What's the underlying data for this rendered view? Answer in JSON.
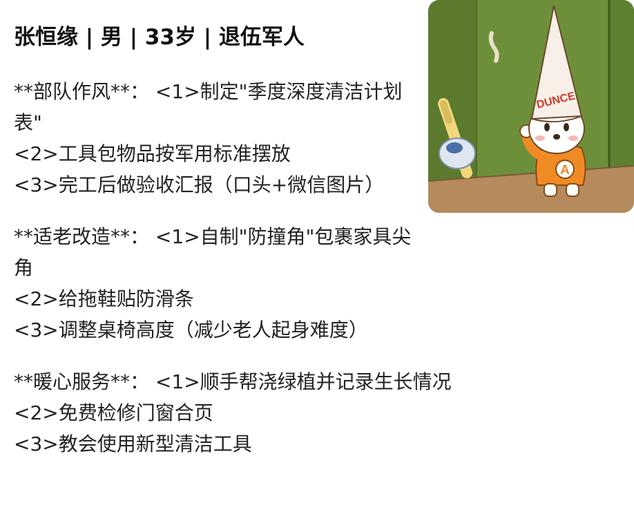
{
  "profile": {
    "title": "张恒缘 | 男 | 33岁 | 退伍军人"
  },
  "sections": [
    {
      "heading": "**部队作风**：",
      "first_item": "<1>制定\"季度深度清洁计划表\"",
      "items": [
        "<2>工具包物品按军用标准摆放",
        "<3>完工后做验收汇报（口头+微信图片）"
      ]
    },
    {
      "heading": "**适老改造**：",
      "first_item": "<1>自制\"防撞角\"包裹家具尖角",
      "items": [
        "<2>给拖鞋贴防滑条",
        "<3>调整桌椅高度（减少老人起身难度）"
      ]
    },
    {
      "heading": "**暖心服务**：",
      "first_item": "<1>顺手帮浇绿植并记录生长情况",
      "items": [
        "<2>免费检修门窗合页",
        "<3>教会使用新型清洁工具"
      ]
    }
  ],
  "image": {
    "hat_text": "DUNCE",
    "shirt_letter": "A",
    "colors": {
      "wall": "#6e8f3a",
      "floor": "#b58a5c",
      "hat": "#f7efe8",
      "shirt": "#f08a24",
      "bat": "#f1d77a"
    }
  }
}
